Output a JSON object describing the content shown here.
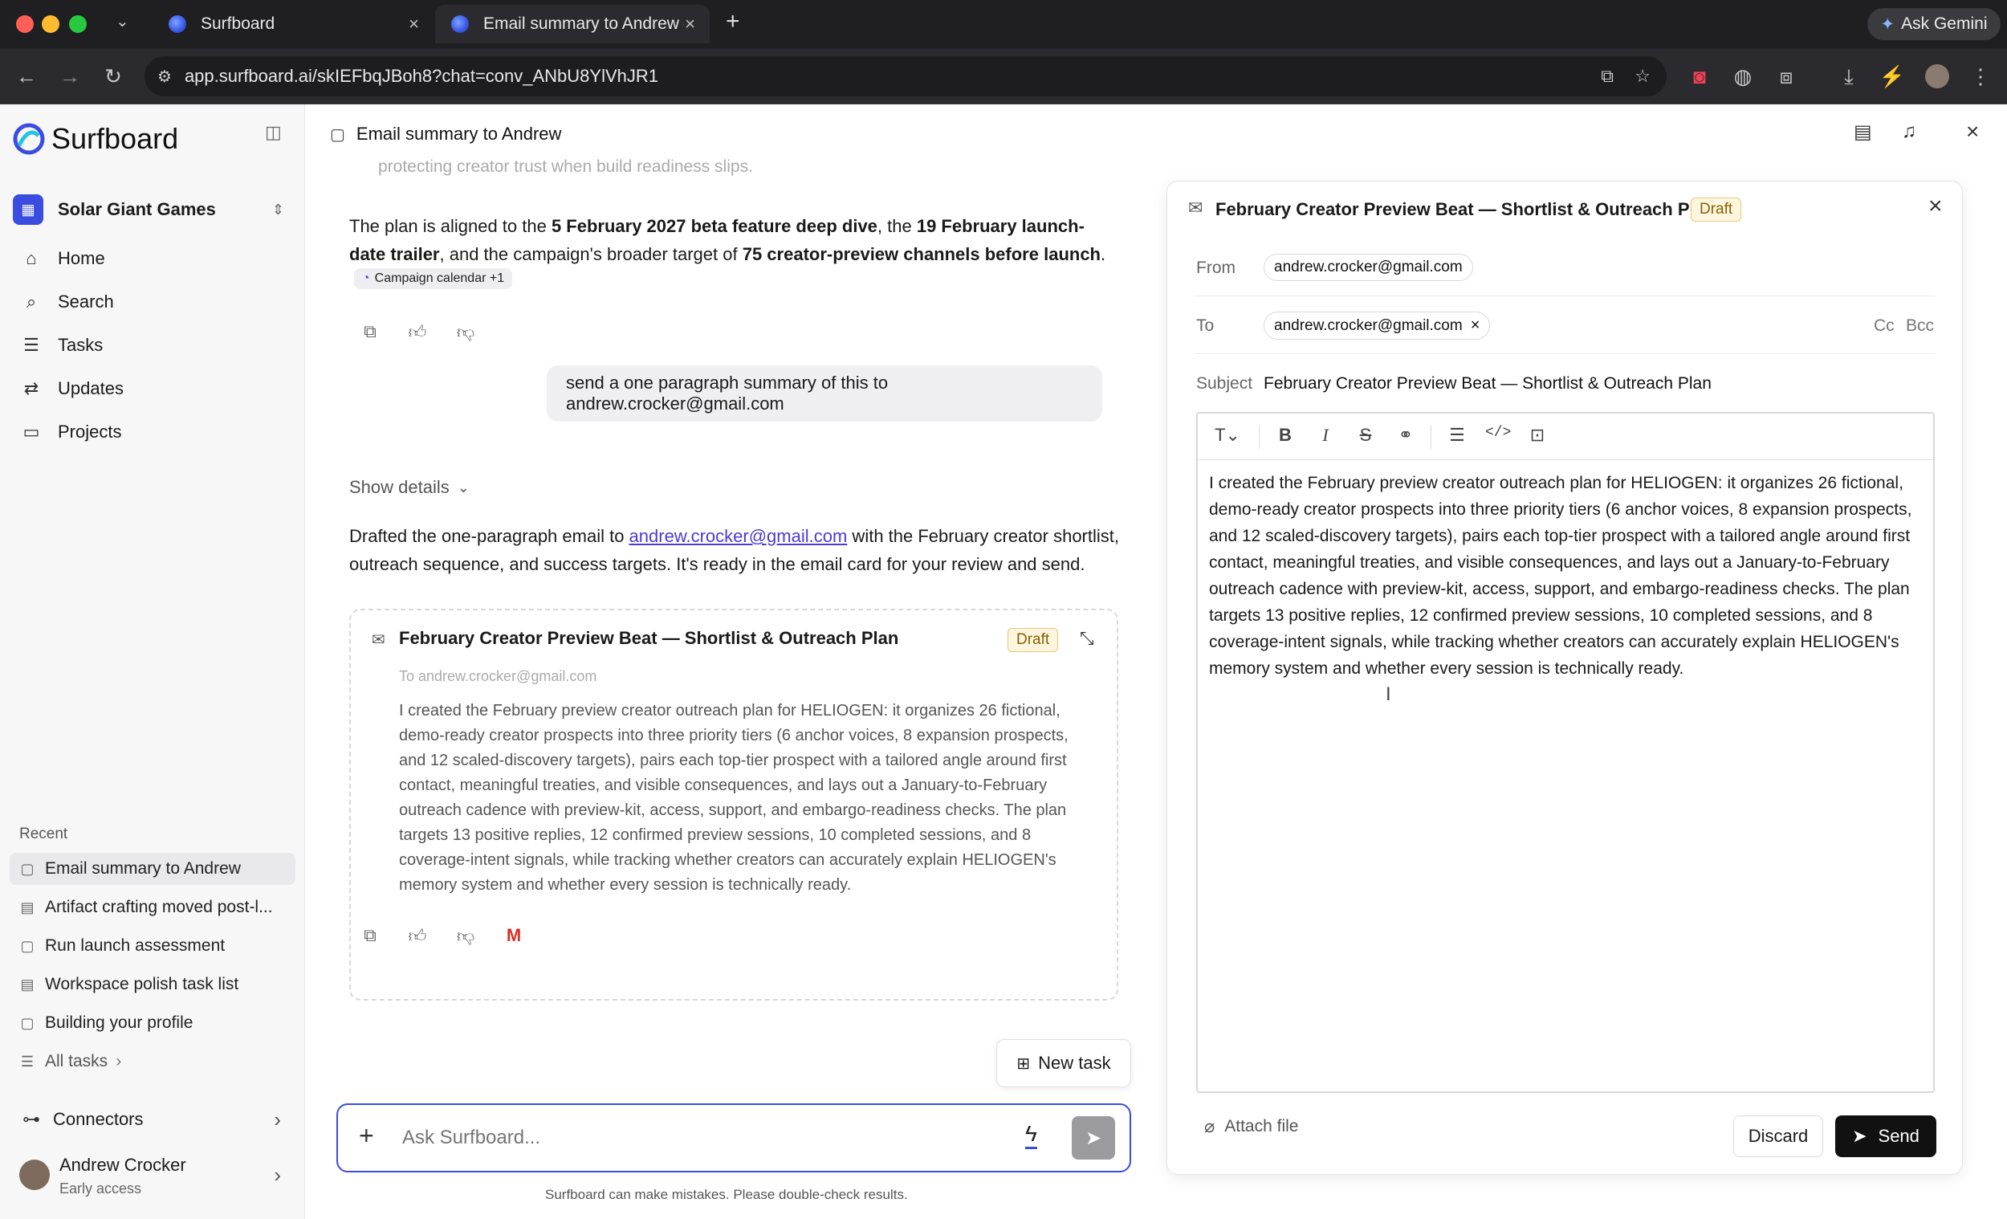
{
  "browser": {
    "tabs": [
      {
        "title": "Surfboard"
      },
      {
        "title": "Email summary to Andrew – S"
      }
    ],
    "url": "app.surfboard.ai/skIEFbqJBoh8?chat=conv_ANbU8YlVhJR1",
    "ask_gemini": "Ask Gemini"
  },
  "sidebar": {
    "brand": "Surfboard",
    "workspace": "Solar Giant Games",
    "nav": [
      {
        "label": "Home",
        "icon": "home-icon"
      },
      {
        "label": "Search",
        "icon": "search-icon"
      },
      {
        "label": "Tasks",
        "icon": "tasks-icon"
      },
      {
        "label": "Updates",
        "icon": "updates-icon"
      },
      {
        "label": "Projects",
        "icon": "folder-icon"
      }
    ],
    "recent_label": "Recent",
    "recent": [
      {
        "label": "Email summary to Andrew",
        "icon": "chat-icon",
        "active": true
      },
      {
        "label": "Artifact crafting moved post-l...",
        "icon": "document-icon"
      },
      {
        "label": "Run launch assessment",
        "icon": "chat-icon"
      },
      {
        "label": "Workspace polish task list",
        "icon": "list-icon"
      },
      {
        "label": "Building your profile",
        "icon": "chat-icon"
      }
    ],
    "all_tasks": "All tasks",
    "connectors": "Connectors",
    "user": {
      "name": "Andrew Crocker",
      "status": "Early access"
    }
  },
  "header": {
    "title": "Email summary to Andrew"
  },
  "chat": {
    "faded_line": "protecting creator trust when build readiness slips.",
    "para1": {
      "p1": "The plan is aligned to the ",
      "b1": "5 February 2027 beta feature deep dive",
      "p2": ", the ",
      "b2": "19 February launch-date trailer",
      "p3": ", and the campaign's broader target of ",
      "b3": "75 creator-preview channels before launch",
      "p4": "."
    },
    "source_chip": "Campaign calendar +1",
    "user_message": "send a one paragraph summary of this to andrew.crocker@gmail.com",
    "show_details": "Show details",
    "reply": {
      "p1": "Drafted the one-paragraph email to ",
      "link": "andrew.crocker@gmail.com",
      "p2": " with the February creator shortlist, outreach sequence, and success targets. It's ready in the email card for your review and send."
    },
    "email_card": {
      "subject": "February Creator Preview Beat — Shortlist & Outreach Plan",
      "badge": "Draft",
      "to_line": "To andrew.crocker@gmail.com",
      "body": "I created the February preview creator outreach plan for HELIOGEN: it organizes 26 fictional, demo-ready creator prospects into three priority tiers (6 anchor voices, 8 expansion prospects, and 12 scaled-discovery targets), pairs each top-tier prospect with a tailored angle around first contact, meaningful treaties, and visible consequences, and lays out a January-to-February outreach cadence with preview-kit, access, support, and embargo-readiness checks. The plan targets 13 positive replies, 12 confirmed preview sessions, 10 completed sessions, and 8 coverage-intent signals, while tracking whether creators can accurately explain HELIOGEN's memory system and whether every session is technically ready."
    },
    "new_task": "New task",
    "input_placeholder": "Ask Surfboard...",
    "disclaimer": "Surfboard can make mistakes. Please double-check results."
  },
  "email_panel": {
    "subject_title": "February Creator Preview Beat — Shortlist & Outreach Plan",
    "badge": "Draft",
    "from_label": "From",
    "from_value": "andrew.crocker@gmail.com",
    "to_label": "To",
    "to_value": "andrew.crocker@gmail.com",
    "cc": "Cc",
    "bcc": "Bcc",
    "subject_label": "Subject",
    "subject_value": "February Creator Preview Beat — Shortlist & Outreach Plan",
    "body": "I created the February preview creator outreach plan for HELIOGEN: it organizes 26 fictional, demo-ready creator prospects into three priority tiers (6 anchor voices, 8 expansion prospects, and 12 scaled-discovery targets), pairs each top-tier prospect with a tailored angle around first contact, meaningful treaties, and visible consequences, and lays out a January-to-February outreach cadence with preview-kit, access, support, and embargo-readiness checks. The plan targets 13 positive replies, 12 confirmed preview sessions, 10 completed sessions, and 8 coverage-intent signals, while tracking whether creators can accurately explain HELIOGEN's memory system and whether every session is technically ready.",
    "attach": "Attach file",
    "discard": "Discard",
    "send": "Send"
  },
  "colors": {
    "accent": "#3b4ce0",
    "link": "#4a3bd8",
    "send_bg": "#111111",
    "draft_badge": "#fff6e0"
  }
}
